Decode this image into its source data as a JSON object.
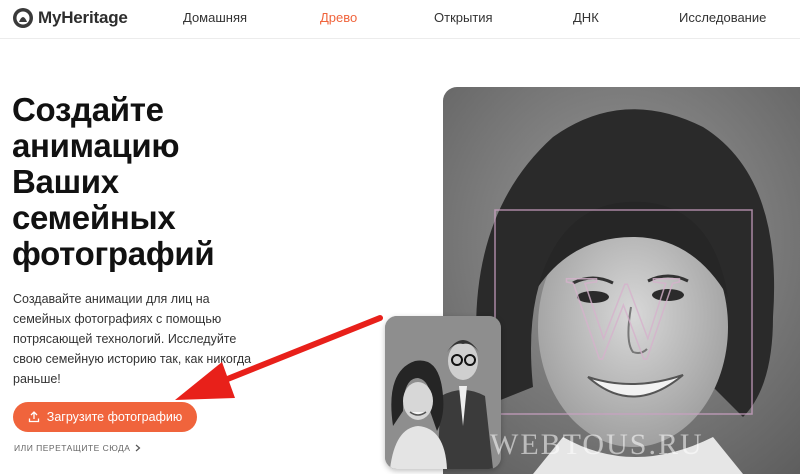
{
  "brand": {
    "name": "MyHeritage",
    "accent": "#f0643c"
  },
  "nav": {
    "items": [
      {
        "label": "Домашняя",
        "active": false
      },
      {
        "label": "Древо",
        "active": true
      },
      {
        "label": "Открытия",
        "active": false
      },
      {
        "label": "ДНК",
        "active": false
      },
      {
        "label": "Исследование",
        "active": false
      }
    ]
  },
  "hero": {
    "title_lines": [
      "Создайте",
      "анимацию",
      "Ваших",
      "семейных",
      "фотографий"
    ],
    "description": "Создавайте анимации для лиц на семейных фотографиях с помощью потрясающей технологий. Исследуйте свою семейную историю так, как никогда раньше!",
    "upload_label": "Загрузите фотографию",
    "drop_label": "ИЛИ ПЕРЕТАЩИТЕ СЮДА"
  },
  "watermark": "WEBTOUS.RU",
  "icons": {
    "upload": "upload-icon",
    "chevron": "chevron-right-icon",
    "logo": "myheritage-logo-icon",
    "arrow": "red-arrow-annotation"
  }
}
